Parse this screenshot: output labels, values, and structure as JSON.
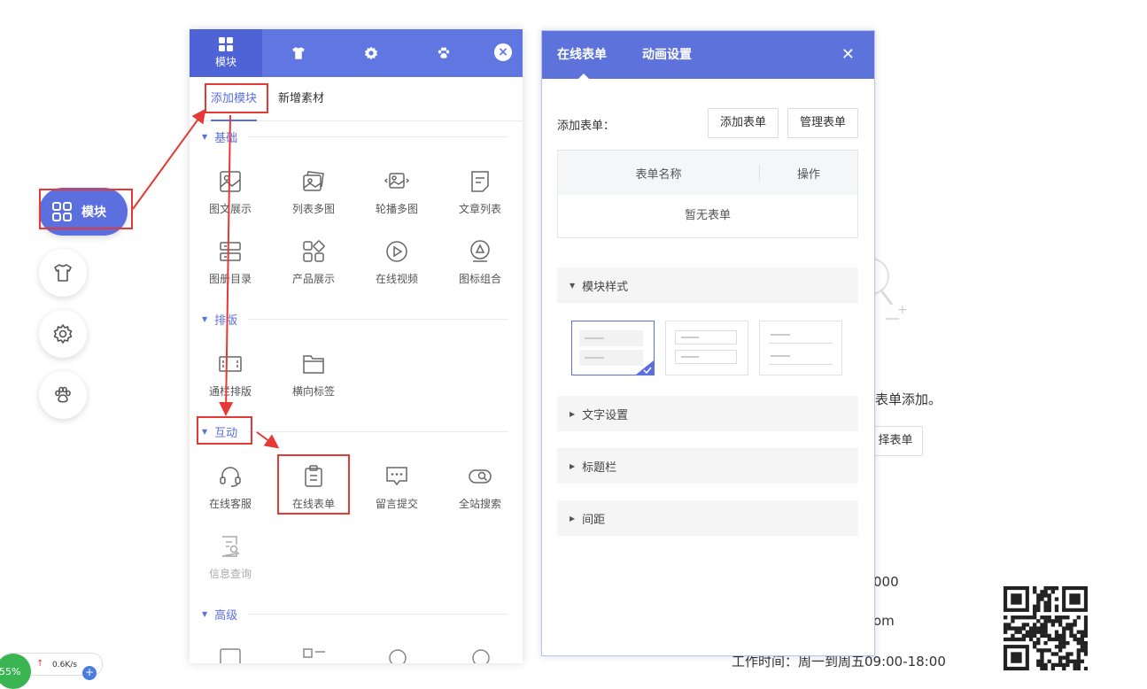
{
  "floating_nav": {
    "modules_label": "模块"
  },
  "module_panel": {
    "tabs": [
      {
        "label": "模块",
        "icon": "grid-icon"
      },
      {
        "label": "",
        "icon": "shirt-icon"
      },
      {
        "label": "",
        "icon": "gear-icon"
      },
      {
        "label": "",
        "icon": "paw-icon"
      }
    ],
    "sub_tabs": [
      "添加模块",
      "新增素材"
    ],
    "sections": {
      "basic": "基础",
      "layout": "排版",
      "interactive": "互动",
      "advanced": "高级"
    },
    "basic_items": [
      "图文展示",
      "列表多图",
      "轮播多图",
      "文章列表",
      "图册目录",
      "产品展示",
      "在线视频",
      "图标组合"
    ],
    "layout_items": [
      "通栏排版",
      "横向标签"
    ],
    "interactive_items": [
      "在线客服",
      "在线表单",
      "留言提交",
      "全站搜索",
      "信息查询"
    ]
  },
  "form_panel": {
    "tabs": [
      "在线表单",
      "动画设置"
    ],
    "add_form_label": "添加表单：",
    "add_form_button": "添加表单",
    "manage_form_button": "管理表单",
    "table": {
      "col_name": "表单名称",
      "col_action": "操作",
      "empty": "暂无表单"
    },
    "accordion": {
      "module_style": "模块样式",
      "text_settings": "文字设置",
      "title_bar": "标题栏",
      "spacing": "间距"
    }
  },
  "background": {
    "hint_text": "表单添加。",
    "select_button": "择表单",
    "phone": "000",
    "email": "om",
    "hours": "工作时间：周一到周五09:00-18:00"
  },
  "status_widget": {
    "percent": "55%",
    "speed": "0.6K/s"
  }
}
